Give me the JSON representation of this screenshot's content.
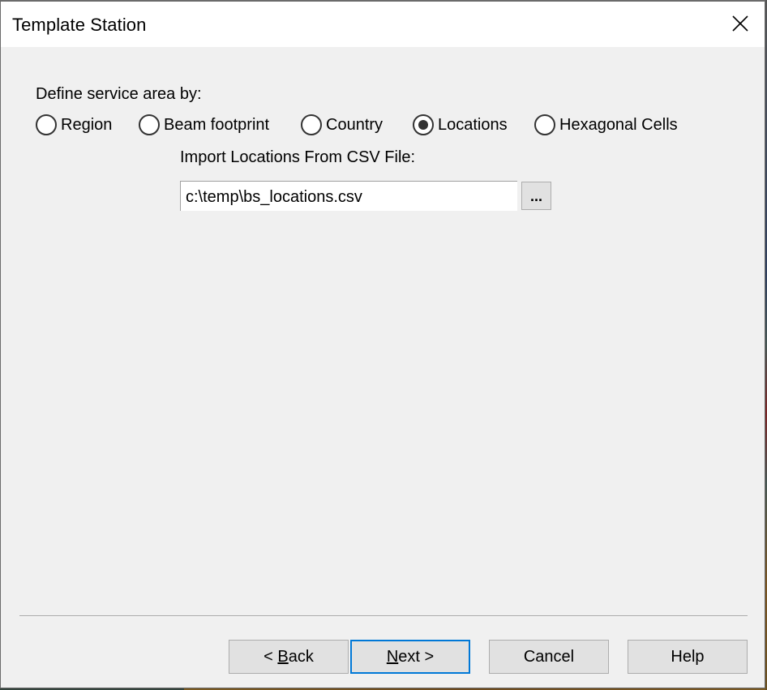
{
  "window": {
    "title": "Template Station",
    "close_icon": "close-icon"
  },
  "service_area": {
    "label": "Define service area by:",
    "options": [
      {
        "label": "Region",
        "checked": false
      },
      {
        "label": "Beam footprint",
        "checked": false
      },
      {
        "label": "Country",
        "checked": false
      },
      {
        "label": "Locations",
        "checked": true
      },
      {
        "label": "Hexagonal Cells",
        "checked": false
      }
    ],
    "selected": "Locations"
  },
  "csv_import": {
    "label": "Import Locations From CSV File:",
    "value": "c:\\temp\\bs_locations.csv",
    "browse_label": "..."
  },
  "footer": {
    "back": {
      "prefix": "< ",
      "mnemonic": "B",
      "rest": "ack"
    },
    "next": {
      "prefix": "",
      "mnemonic": "N",
      "rest": "ext >"
    },
    "cancel_label": "Cancel",
    "help_label": "Help",
    "default_button": "Next",
    "accent_color": "#0078d7"
  }
}
